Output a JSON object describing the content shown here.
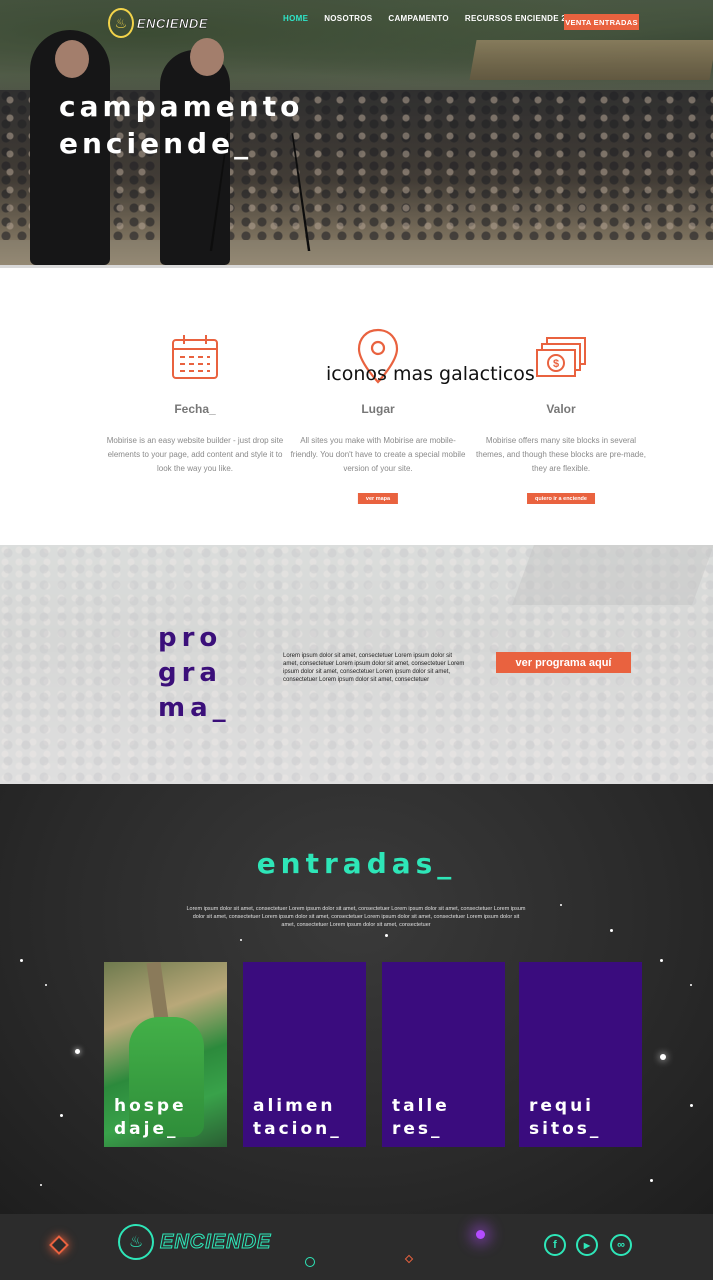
{
  "nav": {
    "logo_text": "ENCIENDE",
    "items": [
      {
        "label": "HOME",
        "active": true
      },
      {
        "label": "NOSOTROS",
        "active": false
      },
      {
        "label": "CAMPAMENTO",
        "active": false
      },
      {
        "label": "RECURSOS ENCIENDE 2017",
        "active": false
      }
    ],
    "cta_label": "VENTA ENTRADAS"
  },
  "hero": {
    "title_line1": "campamento",
    "title_line2": "enciende_"
  },
  "features": {
    "overlay_text": "iconos mas galacticos",
    "items": [
      {
        "icon": "calendar-icon",
        "title": "Fecha_",
        "text": "Mobirise is an easy website builder - just drop site elements to your page, add content and style it to look the way you like.",
        "button": ""
      },
      {
        "icon": "map-pin-icon",
        "title": "Lugar",
        "text": "All sites you make with Mobirise are mobile-friendly. You don't have to create a special mobile version of your site.",
        "button": "ver mapa"
      },
      {
        "icon": "money-icon",
        "title": "Valor",
        "text": "Mobirise offers many site blocks in several themes, and though these blocks are pre-made, they are flexible.",
        "button": "quiero ir a enciende"
      }
    ]
  },
  "programa": {
    "title_line1": "pro",
    "title_line2": "gra",
    "title_line3": "ma_",
    "text": "Lorem ipsum dolor sit amet, consectetuer Lorem ipsum dolor sit amet, consectetuer Lorem ipsum dolor sit amet, consectetuer Lorem ipsum dolor sit amet, consectetuer Lorem ipsum dolor sit amet, consectetuer Lorem ipsum dolor sit amet, consectetuer",
    "button": "ver programa aquí"
  },
  "entradas": {
    "title": "entradas_",
    "text": "Lorem ipsum dolor sit amet, consectetuer Lorem ipsum dolor sit amet, consectetuer Lorem ipsum dolor sit amet, consectetuer Lorem ipsum dolor sit amet, consectetuer Lorem ipsum dolor sit amet, consectetuer Lorem ipsum dolor sit amet, consectetuer Lorem ipsum dolor sit amet, consectetuer Lorem ipsum dolor sit amet, consectetuer",
    "cards": [
      {
        "line1": "hospe",
        "line2": "daje_"
      },
      {
        "line1": "alimen",
        "line2": "tacion_"
      },
      {
        "line1": "talle",
        "line2": "res_"
      },
      {
        "line1": "requi",
        "line2": "sitos_"
      }
    ]
  },
  "footer": {
    "logo_text": "ENCIENDE",
    "social": [
      {
        "icon": "facebook-icon",
        "glyph": "f"
      },
      {
        "icon": "youtube-icon",
        "glyph": "▶"
      },
      {
        "icon": "link-icon",
        "glyph": "∞"
      }
    ]
  },
  "colors": {
    "accent": "#e9623f",
    "purple": "#3a0c7e",
    "teal": "#2ee6b8",
    "nav_active": "#2ee6c9"
  }
}
